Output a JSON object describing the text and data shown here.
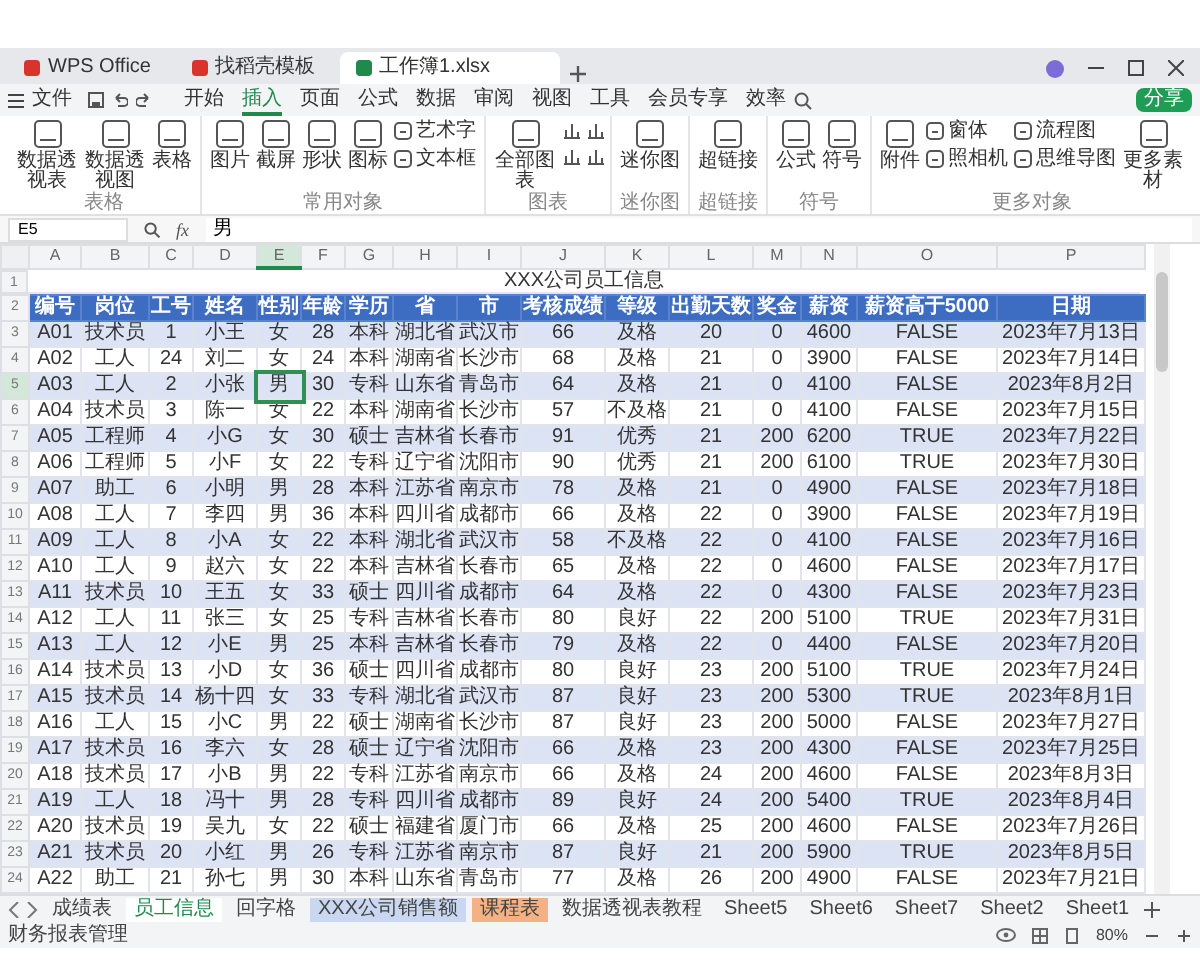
{
  "window": {
    "title_tabs": [
      {
        "label": "WPS Office",
        "kind": "app",
        "selected": false
      },
      {
        "label": "找稻壳模板",
        "kind": "template",
        "selected": false
      },
      {
        "label": "工作簿1.xlsx",
        "kind": "workbook",
        "selected": true
      }
    ],
    "menu": {
      "file": "文件",
      "tabs": [
        {
          "label": "开始",
          "selected": false
        },
        {
          "label": "插入",
          "selected": true
        },
        {
          "label": "页面",
          "selected": false
        },
        {
          "label": "公式",
          "selected": false
        },
        {
          "label": "数据",
          "selected": false
        },
        {
          "label": "审阅",
          "selected": false
        },
        {
          "label": "视图",
          "selected": false
        },
        {
          "label": "工具",
          "selected": false
        },
        {
          "label": "会员专享",
          "selected": false
        },
        {
          "label": "效率",
          "selected": false
        }
      ],
      "share": "分享"
    },
    "ribbon": {
      "groups": [
        {
          "label": "表格",
          "items": [
            {
              "kind": "large",
              "label": "数据透视表"
            },
            {
              "kind": "large",
              "label": "数据透视图"
            },
            {
              "kind": "large",
              "label": "表格"
            }
          ]
        },
        {
          "label": "常用对象",
          "items": [
            {
              "kind": "large",
              "label": "图片"
            },
            {
              "kind": "large",
              "label": "截屏"
            },
            {
              "kind": "large",
              "label": "形状"
            },
            {
              "kind": "large",
              "label": "图标"
            },
            {
              "kind": "stack",
              "labels": [
                "艺术字",
                "文本框"
              ]
            }
          ]
        },
        {
          "label": "图表",
          "items": [
            {
              "kind": "large",
              "label": "全部图表"
            },
            {
              "kind": "icons"
            }
          ]
        },
        {
          "label": "迷你图",
          "items": [
            {
              "kind": "large",
              "label": "迷你图"
            }
          ]
        },
        {
          "label": "超链接",
          "items": [
            {
              "kind": "large",
              "label": "超链接"
            }
          ]
        },
        {
          "label": "符号",
          "items": [
            {
              "kind": "large",
              "label": "公式"
            },
            {
              "kind": "large",
              "label": "符号"
            }
          ]
        },
        {
          "label": "更多对象",
          "items": [
            {
              "kind": "large",
              "label": "附件"
            },
            {
              "kind": "stack",
              "labels": [
                "窗体",
                "照相机"
              ]
            },
            {
              "kind": "stack",
              "labels": [
                "流程图",
                "思维导图"
              ]
            },
            {
              "kind": "large",
              "label": "更多素材"
            }
          ]
        }
      ]
    },
    "formula_bar": {
      "name_box": "E5",
      "function_button": "fx",
      "formula": "男"
    },
    "sheet": {
      "columns": [
        {
          "letter": "A",
          "selected": false
        },
        {
          "letter": "B",
          "selected": false
        },
        {
          "letter": "C",
          "selected": false
        },
        {
          "letter": "D",
          "selected": false
        },
        {
          "letter": "E",
          "selected": true
        },
        {
          "letter": "F",
          "selected": false
        },
        {
          "letter": "G",
          "selected": false
        },
        {
          "letter": "H",
          "selected": false
        },
        {
          "letter": "I",
          "selected": false
        },
        {
          "letter": "J",
          "selected": false
        },
        {
          "letter": "K",
          "selected": false
        },
        {
          "letter": "L",
          "selected": false
        },
        {
          "letter": "M",
          "selected": false
        },
        {
          "letter": "N",
          "selected": false
        },
        {
          "letter": "O",
          "selected": false
        },
        {
          "letter": "P",
          "selected": false
        }
      ],
      "title_row": {
        "number": "1",
        "text": "XXX公司员工信息"
      },
      "rows": [
        {
          "number": "2",
          "kind": "header",
          "selected": false,
          "cells": [
            "编号",
            "岗位",
            "工号",
            "姓名",
            "性别",
            "年龄",
            "学历",
            "省",
            "市",
            "考核成绩",
            "等级",
            "出勤天数",
            "奖金",
            "薪资",
            "薪资高于5000",
            "日期"
          ]
        },
        {
          "number": "3",
          "kind": "data",
          "selected": false,
          "cells": [
            "A01",
            "技术员",
            "1",
            "小王",
            "女",
            "28",
            "本科",
            "湖北省",
            "武汉市",
            "66",
            "及格",
            "20",
            "0",
            "4600",
            "FALSE",
            "2023年7月13日"
          ]
        },
        {
          "number": "4",
          "kind": "data",
          "selected": false,
          "cells": [
            "A02",
            "工人",
            "24",
            "刘二",
            "女",
            "24",
            "本科",
            "湖南省",
            "长沙市",
            "68",
            "及格",
            "21",
            "0",
            "3900",
            "FALSE",
            "2023年7月14日"
          ]
        },
        {
          "number": "5",
          "kind": "data",
          "selected": true,
          "cells": [
            "A03",
            "工人",
            "2",
            "小张",
            "男",
            "30",
            "专科",
            "山东省",
            "青岛市",
            "64",
            "及格",
            "21",
            "0",
            "4100",
            "FALSE",
            "2023年8月2日"
          ]
        },
        {
          "number": "6",
          "kind": "data",
          "selected": false,
          "cells": [
            "A04",
            "技术员",
            "3",
            "陈一",
            "女",
            "22",
            "本科",
            "湖南省",
            "长沙市",
            "57",
            "不及格",
            "21",
            "0",
            "4100",
            "FALSE",
            "2023年7月15日"
          ]
        },
        {
          "number": "7",
          "kind": "data",
          "selected": false,
          "cells": [
            "A05",
            "工程师",
            "4",
            "小G",
            "女",
            "30",
            "硕士",
            "吉林省",
            "长春市",
            "91",
            "优秀",
            "21",
            "200",
            "6200",
            "TRUE",
            "2023年7月22日"
          ]
        },
        {
          "number": "8",
          "kind": "data",
          "selected": false,
          "cells": [
            "A06",
            "工程师",
            "5",
            "小F",
            "女",
            "22",
            "专科",
            "辽宁省",
            "沈阳市",
            "90",
            "优秀",
            "21",
            "200",
            "6100",
            "TRUE",
            "2023年7月30日"
          ]
        },
        {
          "number": "9",
          "kind": "data",
          "selected": false,
          "cells": [
            "A07",
            "助工",
            "6",
            "小明",
            "男",
            "28",
            "本科",
            "江苏省",
            "南京市",
            "78",
            "及格",
            "21",
            "0",
            "4900",
            "FALSE",
            "2023年7月18日"
          ]
        },
        {
          "number": "10",
          "kind": "data",
          "selected": false,
          "cells": [
            "A08",
            "工人",
            "7",
            "李四",
            "男",
            "36",
            "本科",
            "四川省",
            "成都市",
            "66",
            "及格",
            "22",
            "0",
            "3900",
            "FALSE",
            "2023年7月19日"
          ]
        },
        {
          "number": "11",
          "kind": "data",
          "selected": false,
          "cells": [
            "A09",
            "工人",
            "8",
            "小A",
            "女",
            "22",
            "本科",
            "湖北省",
            "武汉市",
            "58",
            "不及格",
            "22",
            "0",
            "4100",
            "FALSE",
            "2023年7月16日"
          ]
        },
        {
          "number": "12",
          "kind": "data",
          "selected": false,
          "cells": [
            "A10",
            "工人",
            "9",
            "赵六",
            "女",
            "22",
            "本科",
            "吉林省",
            "长春市",
            "65",
            "及格",
            "22",
            "0",
            "4600",
            "FALSE",
            "2023年7月17日"
          ]
        },
        {
          "number": "13",
          "kind": "data",
          "selected": false,
          "cells": [
            "A11",
            "技术员",
            "10",
            "王五",
            "女",
            "33",
            "硕士",
            "四川省",
            "成都市",
            "64",
            "及格",
            "22",
            "0",
            "4300",
            "FALSE",
            "2023年7月23日"
          ]
        },
        {
          "number": "14",
          "kind": "data",
          "selected": false,
          "cells": [
            "A12",
            "工人",
            "11",
            "张三",
            "女",
            "25",
            "专科",
            "吉林省",
            "长春市",
            "80",
            "良好",
            "22",
            "200",
            "5100",
            "TRUE",
            "2023年7月31日"
          ]
        },
        {
          "number": "15",
          "kind": "data",
          "selected": false,
          "cells": [
            "A13",
            "工人",
            "12",
            "小E",
            "男",
            "25",
            "本科",
            "吉林省",
            "长春市",
            "79",
            "及格",
            "22",
            "0",
            "4400",
            "FALSE",
            "2023年7月20日"
          ]
        },
        {
          "number": "16",
          "kind": "data",
          "selected": false,
          "cells": [
            "A14",
            "技术员",
            "13",
            "小D",
            "女",
            "36",
            "硕士",
            "四川省",
            "成都市",
            "80",
            "良好",
            "23",
            "200",
            "5100",
            "TRUE",
            "2023年7月24日"
          ]
        },
        {
          "number": "17",
          "kind": "data",
          "selected": false,
          "cells": [
            "A15",
            "技术员",
            "14",
            "杨十四",
            "女",
            "33",
            "专科",
            "湖北省",
            "武汉市",
            "87",
            "良好",
            "23",
            "200",
            "5300",
            "TRUE",
            "2023年8月1日"
          ]
        },
        {
          "number": "18",
          "kind": "data",
          "selected": false,
          "cells": [
            "A16",
            "工人",
            "15",
            "小C",
            "男",
            "22",
            "硕士",
            "湖南省",
            "长沙市",
            "87",
            "良好",
            "23",
            "200",
            "5000",
            "FALSE",
            "2023年7月27日"
          ]
        },
        {
          "number": "19",
          "kind": "data",
          "selected": false,
          "cells": [
            "A17",
            "技术员",
            "16",
            "李六",
            "女",
            "28",
            "硕士",
            "辽宁省",
            "沈阳市",
            "66",
            "及格",
            "23",
            "200",
            "4300",
            "FALSE",
            "2023年7月25日"
          ]
        },
        {
          "number": "20",
          "kind": "data",
          "selected": false,
          "cells": [
            "A18",
            "技术员",
            "17",
            "小B",
            "男",
            "22",
            "专科",
            "江苏省",
            "南京市",
            "66",
            "及格",
            "24",
            "200",
            "4600",
            "FALSE",
            "2023年8月3日"
          ]
        },
        {
          "number": "21",
          "kind": "data",
          "selected": false,
          "cells": [
            "A19",
            "工人",
            "18",
            "冯十",
            "男",
            "28",
            "专科",
            "四川省",
            "成都市",
            "89",
            "良好",
            "24",
            "200",
            "5400",
            "TRUE",
            "2023年8月4日"
          ]
        },
        {
          "number": "22",
          "kind": "data",
          "selected": false,
          "cells": [
            "A20",
            "技术员",
            "19",
            "吴九",
            "女",
            "22",
            "硕士",
            "福建省",
            "厦门市",
            "66",
            "及格",
            "25",
            "200",
            "4600",
            "FALSE",
            "2023年7月26日"
          ]
        },
        {
          "number": "23",
          "kind": "data",
          "selected": false,
          "cells": [
            "A21",
            "技术员",
            "20",
            "小红",
            "男",
            "26",
            "专科",
            "江苏省",
            "南京市",
            "87",
            "良好",
            "21",
            "200",
            "5900",
            "TRUE",
            "2023年8月5日"
          ]
        },
        {
          "number": "24",
          "kind": "data",
          "selected": false,
          "cells": [
            "A22",
            "助工",
            "21",
            "孙七",
            "男",
            "30",
            "本科",
            "山东省",
            "青岛市",
            "77",
            "及格",
            "26",
            "200",
            "4900",
            "FALSE",
            "2023年7月21日"
          ]
        }
      ]
    },
    "sheet_tabs": [
      {
        "label": "成绩表",
        "selected": false
      },
      {
        "label": "员工信息",
        "selected": true
      },
      {
        "label": "回字格",
        "selected": false
      },
      {
        "label": "XXX公司销售额",
        "selected": false,
        "color": "#c9d8f0"
      },
      {
        "label": "课程表",
        "selected": false,
        "color": "#f4b183"
      },
      {
        "label": "数据透视表教程",
        "selected": false
      },
      {
        "label": "Sheet5",
        "selected": false
      },
      {
        "label": "Sheet6",
        "selected": false
      },
      {
        "label": "Sheet7",
        "selected": false
      },
      {
        "label": "Sheet2",
        "selected": false
      },
      {
        "label": "Sheet1",
        "selected": false
      }
    ],
    "status_bar": {
      "left": "财务报表管理",
      "zoom": "80%"
    }
  }
}
